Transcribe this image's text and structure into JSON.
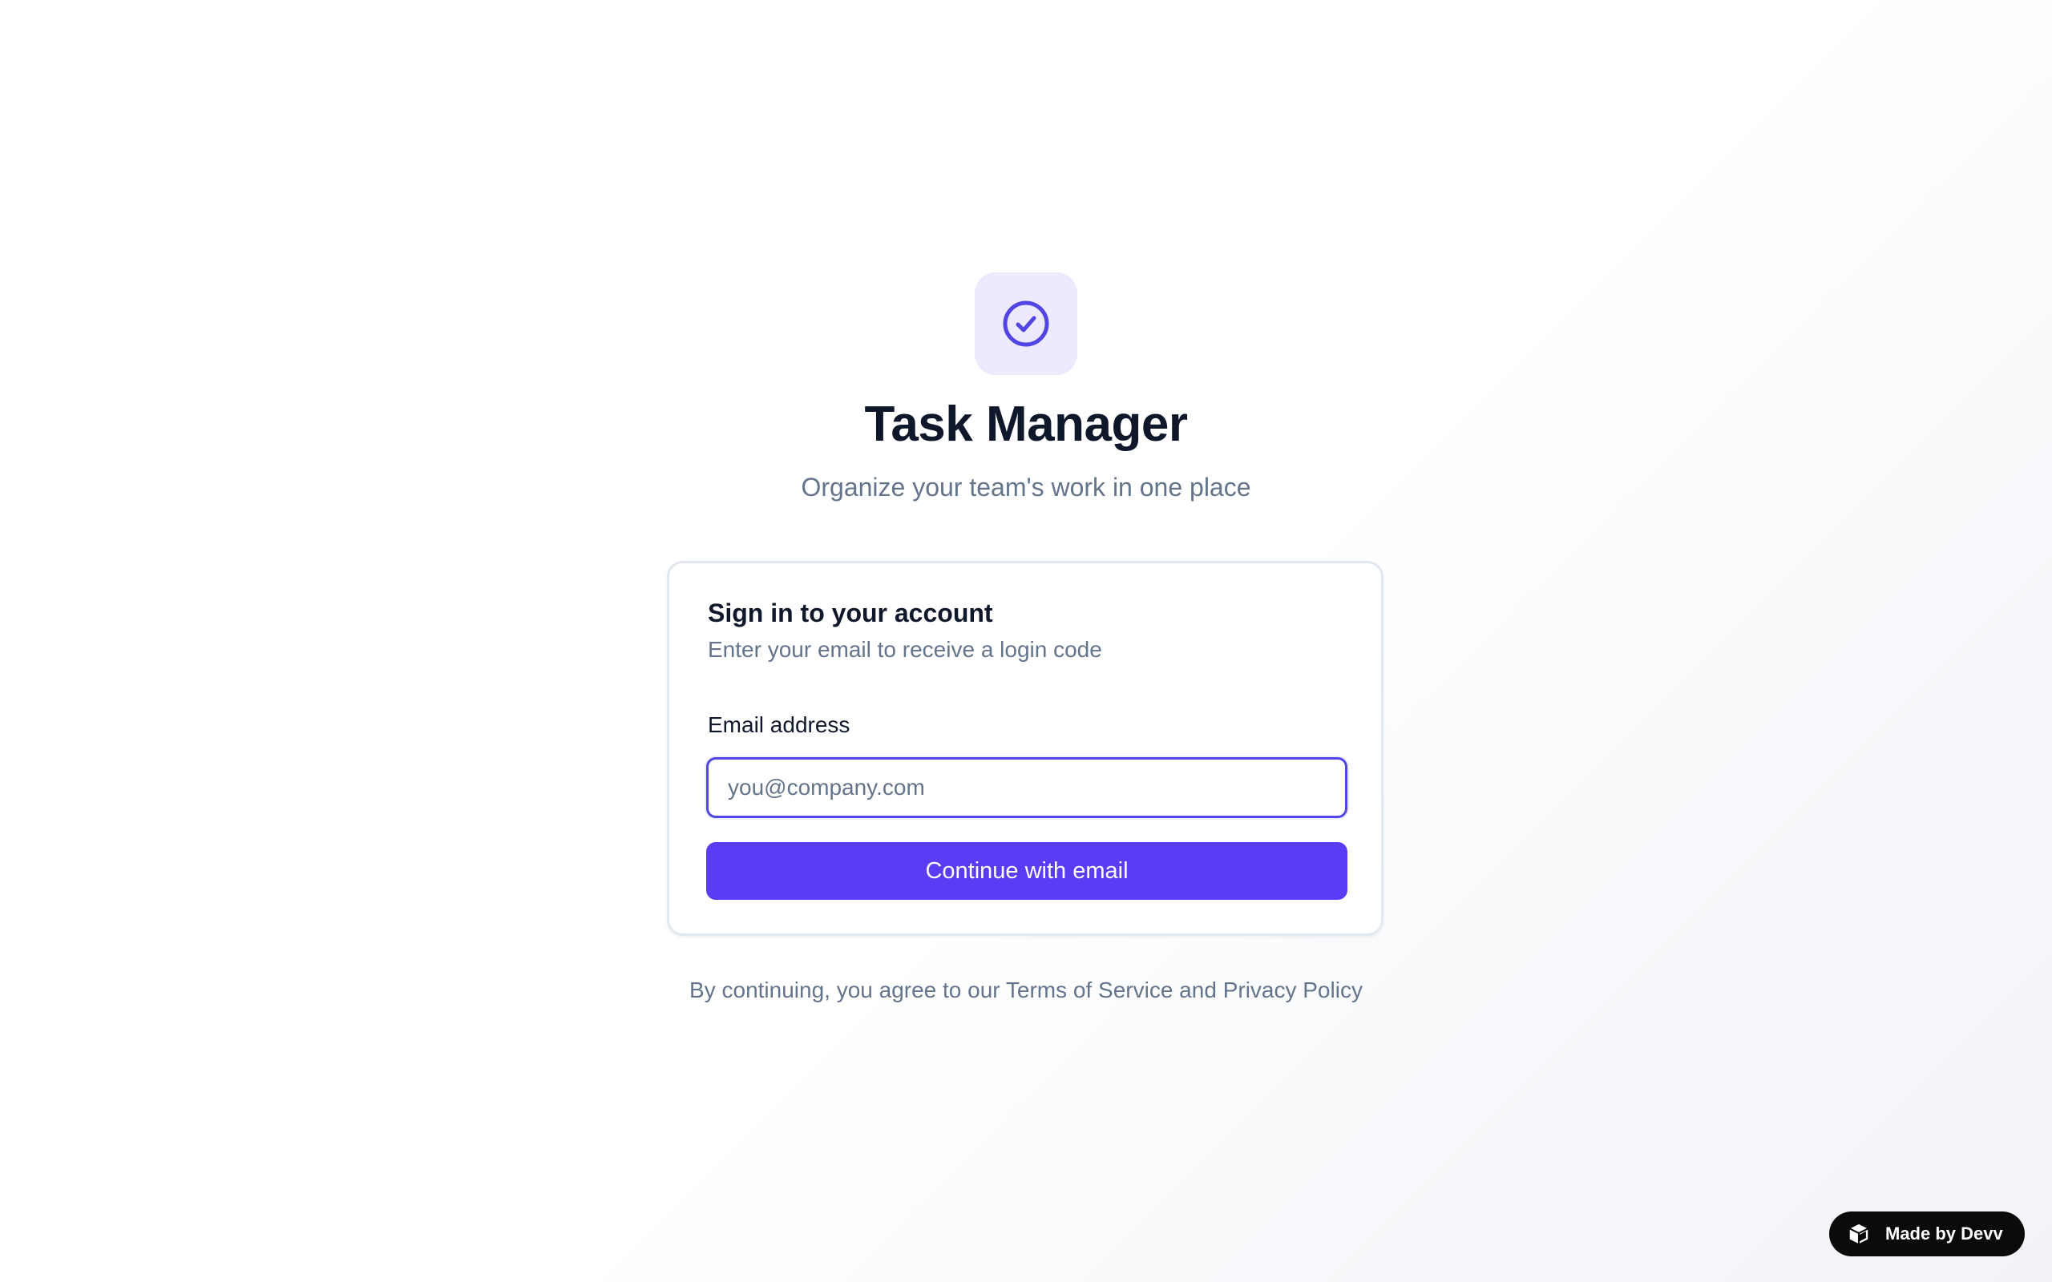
{
  "app": {
    "title": "Task Manager",
    "tagline": "Organize your team's work in one place",
    "logo_icon": "check-circle-icon",
    "accent_color": "#5b3cf5",
    "logo_bg_color": "#ede9fe"
  },
  "signin": {
    "title": "Sign in to your account",
    "subtitle": "Enter your email to receive a login code",
    "email_label": "Email address",
    "email_value": "",
    "email_placeholder": "you@company.com",
    "submit_label": "Continue with email"
  },
  "legal": {
    "prefix": "By continuing, you agree to our ",
    "terms_label": "Terms of Service",
    "conjunction": " and ",
    "privacy_label": "Privacy Policy"
  },
  "badge": {
    "label": "Made by Devv",
    "icon": "cube-icon"
  }
}
